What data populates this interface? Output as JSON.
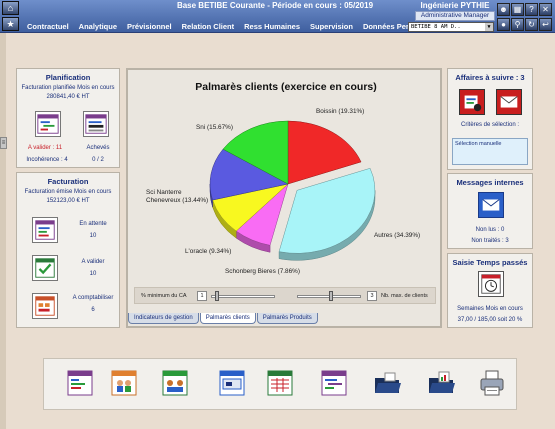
{
  "header": {
    "app_title": "Base BETIBE Courante  -  Période en cours  :  05/2019",
    "company": "Ingénierie PYTHIE",
    "role": "Administrative Manager",
    "user_combo": "BETIBE   8   AM     D.."
  },
  "menu": [
    "Contractuel",
    "Analytique",
    "Prévisionnel",
    "Relation Client",
    "Ress Humaines",
    "Supervision",
    "Données Perso"
  ],
  "planification": {
    "title": "Planification",
    "subtitle": "Facturation planifiée Mois en cours",
    "amount": "280841,40 € HT",
    "a_valider": "A valider : 11",
    "incoherence": "Incohérence : 4",
    "acheves_label": "Achevés",
    "acheves_value": "0 / 2"
  },
  "facturation": {
    "title": "Facturation",
    "subtitle": "Facturation émise Mois en cours",
    "amount": "152123,00 € HT",
    "items": [
      {
        "label": "En attente",
        "value": "10"
      },
      {
        "label": "A valider",
        "value": "10"
      },
      {
        "label": "A comptabiliser",
        "value": "6"
      }
    ]
  },
  "chart_data": {
    "type": "pie",
    "title": "Palmarès clients (exercice en cours)",
    "slices": [
      {
        "name": "Boissin (19.31%)",
        "value": 19.31,
        "color": "#f02828"
      },
      {
        "name": "Autres (34.39%)",
        "value": 34.39,
        "color": "#a8f4f8"
      },
      {
        "name": "Schonberg Bieres (7.86%)",
        "value": 7.86,
        "color": "#f96cf4"
      },
      {
        "name": "L'oracle (9.34%)",
        "value": 9.34,
        "color": "#f8f820"
      },
      {
        "name": "Sci Nanterre Chenevreux (13.44%)",
        "value": 13.44,
        "color": "#5a5ae0"
      },
      {
        "name": "Sni (15.67%)",
        "value": 15.67,
        "color": "#30e030"
      }
    ],
    "exploded": "Autres (34.39%)"
  },
  "controls": {
    "min_ca_label": "% minimum du CA",
    "min_ca_value": "1",
    "max_clients_label": "Nb. max. de clients",
    "max_clients_value": "3"
  },
  "tabs": [
    "Indicateurs de gestion",
    "Palmarès clients",
    "Palmarès Produits"
  ],
  "affaires": {
    "title": "Affaires à suivre : 3",
    "criteria_label": "Critères de sélection :",
    "criteria_value": "Sélection manuelle"
  },
  "messages": {
    "title": "Messages internes",
    "non_lus": "Non lus : 0",
    "non_traites": "Non traités : 3"
  },
  "saisie": {
    "title": "Saisie Temps passés",
    "line1": "Semaines Mois en cours",
    "line2": "37,00 / 185,00 soit 20 %"
  },
  "bottom_icons": [
    "report-icon",
    "people-icon",
    "team-icon",
    "invoice-icon",
    "spreadsheet-icon",
    "tasks-icon",
    "folder-open-icon",
    "folder-chart-icon",
    "printer-icon"
  ],
  "colors": {
    "accent_blue": "#1a2f7a",
    "alert_red": "#c8202a",
    "toolbar_blue": "#4f6fae",
    "background": "#e9ddd0"
  }
}
